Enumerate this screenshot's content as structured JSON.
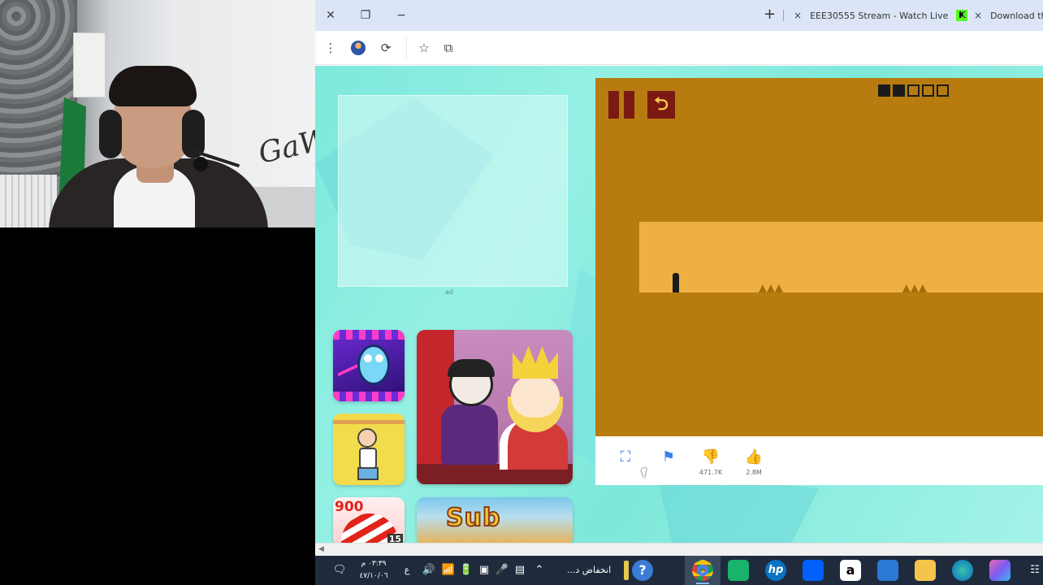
{
  "webcam": {
    "wall_text": "GaW"
  },
  "browser": {
    "tabs": [
      {
        "label": "EEE30555 Stream - Watch Live",
        "close": "×"
      },
      {
        "label": "Download th",
        "close": "×"
      }
    ],
    "new_tab": "+",
    "kick_logo": "K",
    "window_controls": {
      "close": "✕",
      "restore": "❐",
      "minimize": "−"
    },
    "toolbar_icons": {
      "menu": "⋮",
      "extensions": "⟳",
      "bookmark": "☆",
      "tab_search": "⧉"
    }
  },
  "page": {
    "ad_label": "ad",
    "game_thumbs": {
      "count_badge": "900",
      "level_badge": "15",
      "subway_logo": "SUBWAY SURFERS"
    },
    "game": {
      "progress": {
        "total": 5,
        "completed": 2
      },
      "restart_glyph": "⮌"
    },
    "game_bar": {
      "fullscreen_icon": "⛶",
      "report_icon": "⚑",
      "dislike_icon": "👎",
      "like_icon": "👍",
      "dislikes": "471.7K",
      "likes": "2.8M"
    }
  },
  "taskbar": {
    "clock_time": "٠٣:٣٩ م",
    "clock_date": "٤٧/١٠/٠٦",
    "lang": "ع",
    "weather": "انخفاض د..."
  },
  "colors": {
    "page_bg": "#7de9dc",
    "game_bg": "#b87b0f",
    "platform": "#eeb141",
    "button_dark": "#7a1a12",
    "action_blue": "#3a82e8",
    "taskbar_bg": "#1f2b3d"
  }
}
